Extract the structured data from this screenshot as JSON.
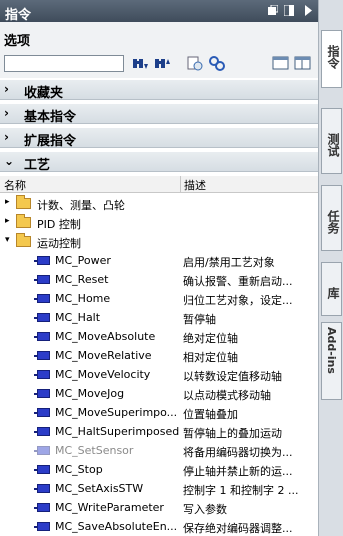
{
  "title": "指令",
  "options": {
    "label": "选项",
    "search_placeholder": ""
  },
  "sections": {
    "favorites": {
      "arrow": "›",
      "label": "收藏夹"
    },
    "basic": {
      "arrow": "›",
      "label": "基本指令"
    },
    "extended": {
      "arrow": "›",
      "label": "扩展指令"
    },
    "tech": {
      "arrow": "⌄",
      "label": "工艺"
    }
  },
  "columns": {
    "name": "名称",
    "desc": "描述"
  },
  "folders": [
    {
      "toggle": "▸",
      "label": "计数、测量、凸轮"
    },
    {
      "toggle": "▸",
      "label": "PID 控制"
    },
    {
      "toggle": "▾",
      "label": "运动控制"
    }
  ],
  "instructions": [
    {
      "name": "MC_Power",
      "desc": "启用/禁用工艺对象"
    },
    {
      "name": "MC_Reset",
      "desc": "确认报警、重新启动..."
    },
    {
      "name": "MC_Home",
      "desc": "归位工艺对象，设定..."
    },
    {
      "name": "MC_Halt",
      "desc": "暂停轴"
    },
    {
      "name": "MC_MoveAbsolute",
      "desc": "绝对定位轴"
    },
    {
      "name": "MC_MoveRelative",
      "desc": "相对定位轴"
    },
    {
      "name": "MC_MoveVelocity",
      "desc": "以转数设定值移动轴"
    },
    {
      "name": "MC_MoveJog",
      "desc": "以点动模式移动轴"
    },
    {
      "name": "MC_MoveSuperimpo...",
      "desc": "位置轴叠加"
    },
    {
      "name": "MC_HaltSuperimposed",
      "desc": "暂停轴上的叠加运动"
    },
    {
      "name": "MC_SetSensor",
      "desc": "将备用编码器切换为..."
    },
    {
      "name": "MC_Stop",
      "desc": "停止轴并禁止新的运..."
    },
    {
      "name": "MC_SetAxisSTW",
      "desc": "控制字 1 和控制字 2 ..."
    },
    {
      "name": "MC_WriteParameter",
      "desc": "写入参数"
    },
    {
      "name": "MC_SaveAbsoluteEn...",
      "desc": "保存绝对编码器调整..."
    }
  ],
  "side_tabs": [
    "指令",
    "测试",
    "任务",
    "库",
    "Add-ins"
  ],
  "colors": {
    "titlebar": "#4a5766",
    "block_icon": "#2b3cc8",
    "folder": "#f4c84e"
  }
}
